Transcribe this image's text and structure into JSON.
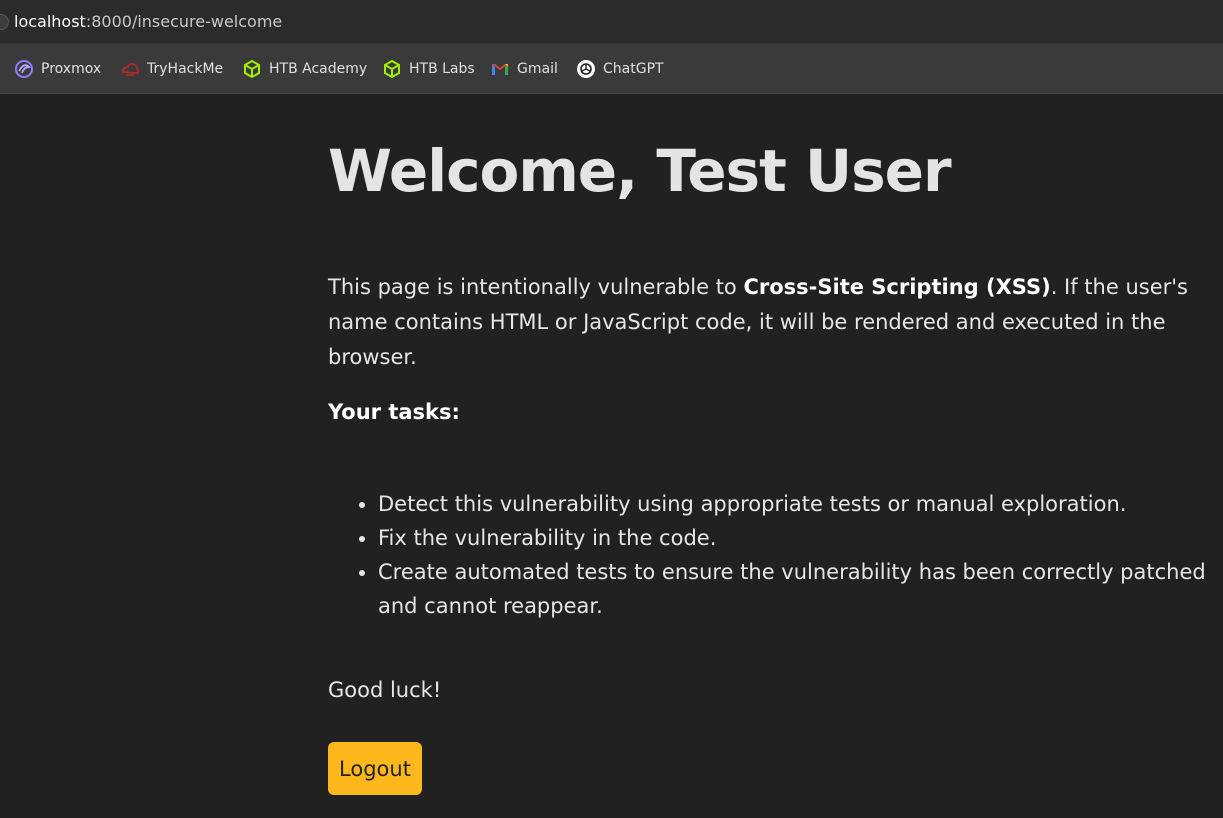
{
  "browser": {
    "url_host": "localhost",
    "url_rest": ":8000/insecure-welcome",
    "bookmarks": [
      {
        "label": "Proxmox",
        "icon": "proxmox-icon"
      },
      {
        "label": "TryHackMe",
        "icon": "tryhackme-icon"
      },
      {
        "label": "HTB Academy",
        "icon": "htb-cube-icon"
      },
      {
        "label": "HTB Labs",
        "icon": "htb-cube-icon"
      },
      {
        "label": "Gmail",
        "icon": "gmail-icon"
      },
      {
        "label": "ChatGPT",
        "icon": "chatgpt-icon"
      }
    ]
  },
  "page": {
    "title": "Welcome, Test User",
    "intro_before": "This page is intentionally vulnerable to ",
    "intro_bold": "Cross-Site Scripting (XSS)",
    "intro_after": ". If the user's name contains HTML or JavaScript code, it will be rendered and executed in the browser.",
    "tasks_heading": "Your tasks:",
    "tasks": [
      "Detect this vulnerability using appropriate tests or manual exploration.",
      "Fix the vulnerability in the code.",
      "Create automated tests to ensure the vulnerability has been correctly patched and cannot reappear."
    ],
    "closing": "Good luck!",
    "logout_label": "Logout"
  },
  "colors": {
    "background": "#212121",
    "logout_button": "#ffb81c",
    "htb_green": "#9fef00"
  }
}
